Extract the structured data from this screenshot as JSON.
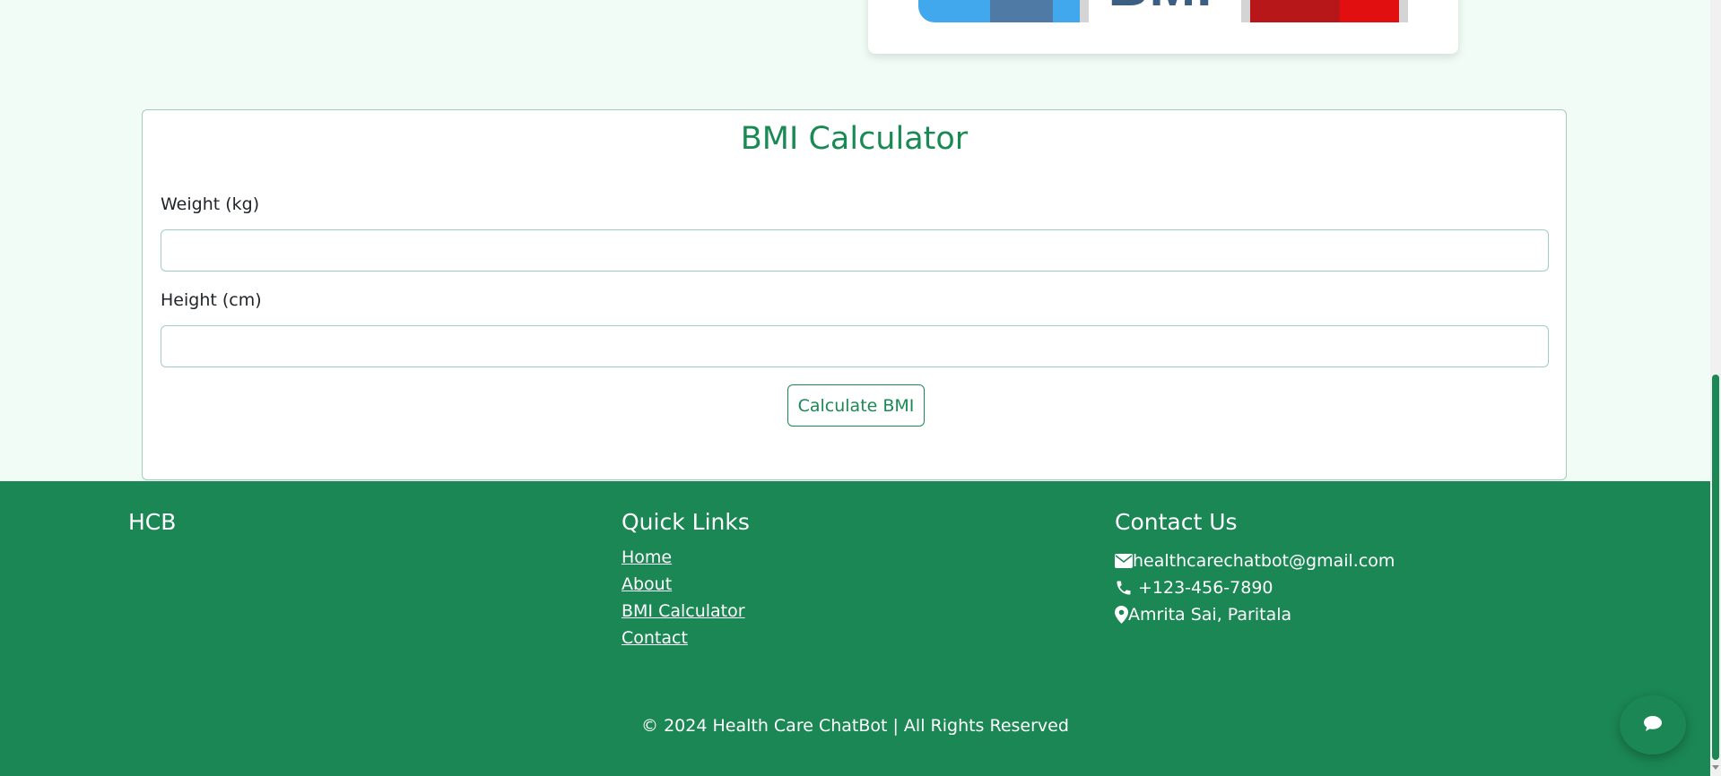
{
  "hero": {
    "gauge_text": "BMI"
  },
  "bmi": {
    "title": "BMI Calculator",
    "weight_label": "Weight (kg)",
    "weight_value": "",
    "height_label": "Height (cm)",
    "height_value": "",
    "button_label": "Calculate BMI"
  },
  "footer": {
    "brand": "HCB",
    "quick_links_title": "Quick Links",
    "links": [
      "Home",
      "About",
      "BMI Calculator",
      "Contact"
    ],
    "contact_title": "Contact Us",
    "email": "healthcarechatbot@gmail.com",
    "phone": "+123-456-7890",
    "address": "Amrita Sai, Paritala",
    "copyright": "© 2024 Health Care ChatBot | All Rights Reserved"
  },
  "icons": {
    "email": "envelope-icon",
    "phone": "phone-icon",
    "address": "map-marker-icon",
    "chat": "chat-bubble-icon"
  },
  "colors": {
    "accent": "#1a8a55",
    "footer_bg": "#1b8754",
    "page_bg": "#f1fcf6"
  }
}
